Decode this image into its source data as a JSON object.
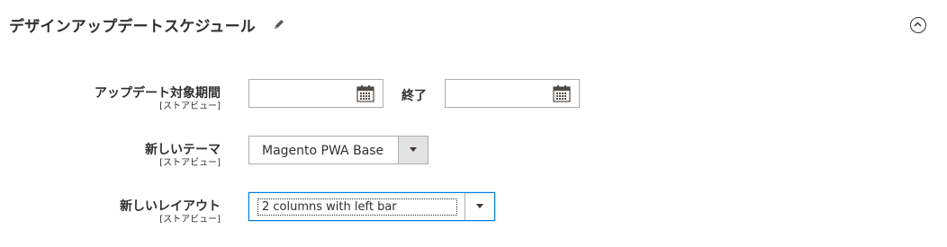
{
  "section": {
    "title": "デザインアップデートスケジュール"
  },
  "fields": {
    "date_range": {
      "label": "アップデート対象期間",
      "scope": "[ストアビュー]",
      "from_value": "",
      "to_label": "終了",
      "to_value": ""
    },
    "theme": {
      "label": "新しいテーマ",
      "scope": "[ストアビュー]",
      "value": "Magento PWA Base"
    },
    "layout": {
      "label": "新しいレイアウト",
      "scope": "[ストアビュー]",
      "value": "2 columns with left bar"
    }
  },
  "icons": {
    "edit": "pencil-icon",
    "collapse": "chevron-up-circle-icon",
    "calendar": "calendar-icon",
    "dropdown": "caret-down-icon"
  }
}
